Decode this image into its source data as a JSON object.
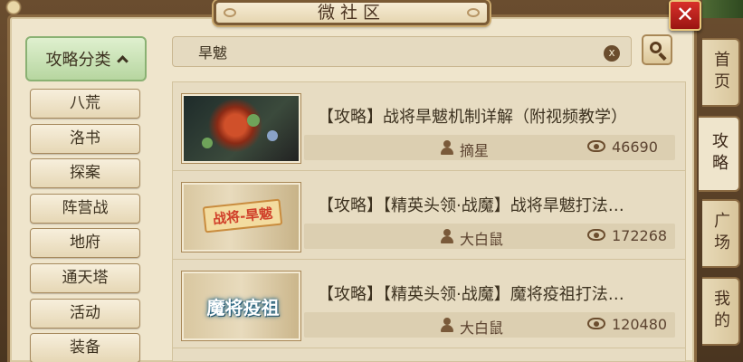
{
  "window": {
    "title": "微社区",
    "close_label": "✕"
  },
  "tabs": [
    {
      "label": "首页",
      "active": false
    },
    {
      "label": "攻略",
      "active": true
    },
    {
      "label": "广场",
      "active": false
    },
    {
      "label": "我的",
      "active": false
    }
  ],
  "sidebar": {
    "header_label": "攻略分类",
    "items": [
      "八荒",
      "洛书",
      "探案",
      "阵营战",
      "地府",
      "通天塔",
      "活动",
      "装备"
    ]
  },
  "search": {
    "value": "旱魃",
    "clear_label": "x"
  },
  "articles": [
    {
      "title": "【攻略】战将旱魃机制详解（附视频教学）",
      "author": "摘星",
      "views": "46690",
      "thumb_text": ""
    },
    {
      "title": "【攻略】【精英头领·战魔】战将旱魃打法…",
      "author": "大白鼠",
      "views": "172268",
      "thumb_text": "战将-旱魃"
    },
    {
      "title": "【攻略】【精英头领·战魔】魔将疫祖打法…",
      "author": "大白鼠",
      "views": "120480",
      "thumb_text": "魔将疫祖"
    }
  ],
  "colors": {
    "accent_green": "#b7d6a0",
    "parchment": "#efe5cc",
    "close_red": "#d8302a"
  }
}
